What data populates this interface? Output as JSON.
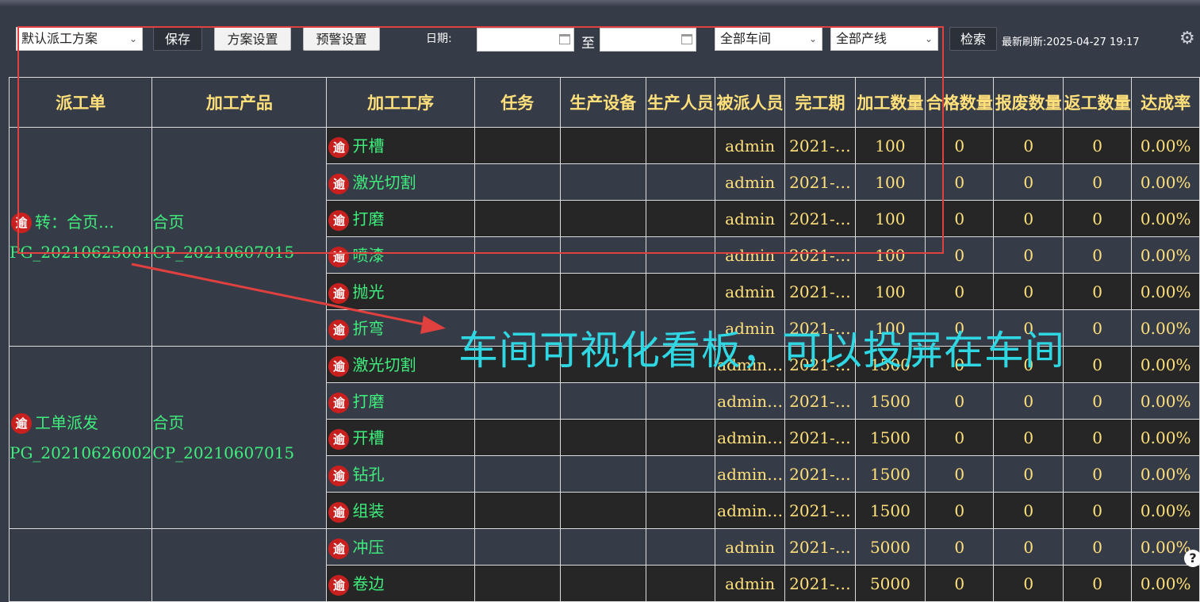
{
  "toolbar": {
    "scheme_value": "默认派工方案",
    "save_label": "保存",
    "scheme_settings_label": "方案设置",
    "warning_settings_label": "预警设置",
    "date_label": "日期:",
    "date_to_label": "至",
    "workshop_value": "全部车间",
    "line_value": "全部产线",
    "search_label": "检索",
    "last_refresh": "最新刷新:2025-04-27 19:17"
  },
  "table": {
    "headers": [
      "派工单",
      "加工产品",
      "加工工序",
      "任务",
      "生产设备",
      "生产人员",
      "被派人员",
      "完工期",
      "加工数量",
      "合格数量",
      "报废数量",
      "返工数量",
      "达成率"
    ],
    "overdue_badge": "逾",
    "groups": [
      {
        "order_name": "转：合页…",
        "order_code": "PG_20210625001",
        "product_name": "合页",
        "product_code": "CP_20210607015",
        "rows": [
          {
            "process": "开槽",
            "assignee": "admin",
            "due": "2021-…",
            "qty": "100",
            "ok": "0",
            "scrap": "0",
            "rework": "0",
            "rate": "0.00%"
          },
          {
            "process": "激光切割",
            "assignee": "admin",
            "due": "2021-…",
            "qty": "100",
            "ok": "0",
            "scrap": "0",
            "rework": "0",
            "rate": "0.00%"
          },
          {
            "process": "打磨",
            "assignee": "admin",
            "due": "2021-…",
            "qty": "100",
            "ok": "0",
            "scrap": "0",
            "rework": "0",
            "rate": "0.00%"
          },
          {
            "process": "喷漆",
            "assignee": "admin",
            "due": "2021-…",
            "qty": "100",
            "ok": "0",
            "scrap": "0",
            "rework": "0",
            "rate": "0.00%"
          },
          {
            "process": "抛光",
            "assignee": "admin",
            "due": "2021-…",
            "qty": "100",
            "ok": "0",
            "scrap": "0",
            "rework": "0",
            "rate": "0.00%"
          },
          {
            "process": "折弯",
            "assignee": "admin",
            "due": "2021-…",
            "qty": "100",
            "ok": "0",
            "scrap": "0",
            "rework": "0",
            "rate": "0.00%"
          }
        ]
      },
      {
        "order_name": "工单派发",
        "order_code": "PG_20210626002",
        "product_name": "合页",
        "product_code": "CP_20210607015",
        "rows": [
          {
            "process": "激光切割",
            "assignee": "admin…",
            "due": "2021-…",
            "qty": "1500",
            "ok": "0",
            "scrap": "0",
            "rework": "0",
            "rate": "0.00%"
          },
          {
            "process": "打磨",
            "assignee": "admin…",
            "due": "2021-…",
            "qty": "1500",
            "ok": "0",
            "scrap": "0",
            "rework": "0",
            "rate": "0.00%"
          },
          {
            "process": "开槽",
            "assignee": "admin…",
            "due": "2021-…",
            "qty": "1500",
            "ok": "0",
            "scrap": "0",
            "rework": "0",
            "rate": "0.00%"
          },
          {
            "process": "钻孔",
            "assignee": "admin…",
            "due": "2021-…",
            "qty": "1500",
            "ok": "0",
            "scrap": "0",
            "rework": "0",
            "rate": "0.00%"
          },
          {
            "process": "组装",
            "assignee": "admin…",
            "due": "2021-…",
            "qty": "1500",
            "ok": "0",
            "scrap": "0",
            "rework": "0",
            "rate": "0.00%"
          }
        ]
      },
      {
        "order_name": "",
        "order_code": "",
        "product_name": "",
        "product_code": "",
        "rows": [
          {
            "process": "冲压",
            "assignee": "admin",
            "due": "2021-…",
            "qty": "5000",
            "ok": "0",
            "scrap": "0",
            "rework": "0",
            "rate": "0.00%"
          },
          {
            "process": "卷边",
            "assignee": "admin",
            "due": "2021-…",
            "qty": "5000",
            "ok": "0",
            "scrap": "0",
            "rework": "0",
            "rate": "0.00%"
          }
        ]
      }
    ]
  },
  "annotation": {
    "text": "车间可视化看板，可以投屏在车间",
    "color": "#2fd7e2",
    "box_color": "#e0403e"
  },
  "colors": {
    "header_text": "#ffe07a",
    "process_text": "#3fef7d",
    "overdue_badge": "#c8201e"
  }
}
